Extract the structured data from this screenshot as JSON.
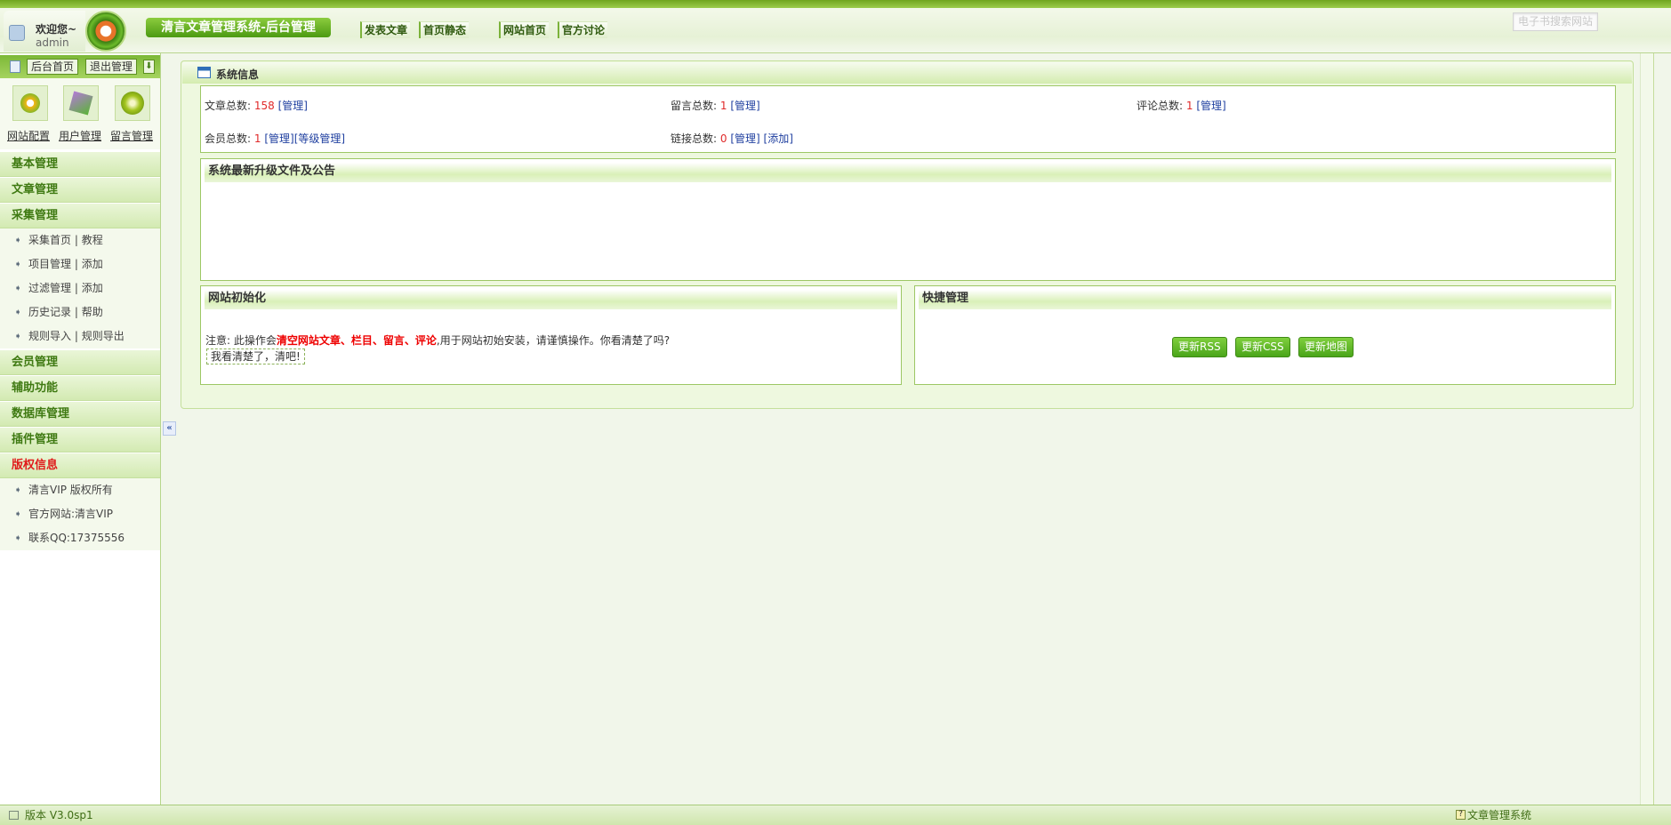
{
  "header": {
    "welcome": "欢迎您~",
    "username": "admin",
    "title": "清言文章管理系统-后台管理",
    "nav": [
      "发表文章",
      "首页静态",
      "网站首页",
      "官方讨论"
    ],
    "search_placeholder": "电子书搜索网站"
  },
  "sidebar": {
    "toolbar": [
      "后台首页",
      "退出管理"
    ],
    "quick": [
      "网站配置",
      "用户管理",
      "留言管理"
    ],
    "menus": {
      "basic": "基本管理",
      "article": "文章管理",
      "collect": "采集管理",
      "collect_items": [
        [
          "采集首页",
          "教程"
        ],
        [
          "项目管理",
          "添加"
        ],
        [
          "过滤管理",
          "添加"
        ],
        [
          "历史记录",
          "帮助"
        ],
        [
          "规则导入",
          "规则导出"
        ]
      ],
      "member": "会员管理",
      "aux": "辅助功能",
      "db": "数据库管理",
      "plugin": "插件管理",
      "copyright": "版权信息",
      "copyright_items": [
        "清言VIP 版权所有",
        "官方网站:清言VIP",
        "联系QQ:17375556"
      ]
    },
    "collapse": "«"
  },
  "main": {
    "panel_title": "系统信息",
    "stats": {
      "articles": {
        "label": "文章总数:",
        "value": "158",
        "links": [
          "[管理]"
        ]
      },
      "messages": {
        "label": "留言总数:",
        "value": "1",
        "links": [
          "[管理]"
        ]
      },
      "comments": {
        "label": "评论总数:",
        "value": "1",
        "links": [
          "[管理]"
        ]
      },
      "members": {
        "label": "会员总数:",
        "value": "1",
        "links": [
          "[管理]",
          "[等级管理]"
        ]
      },
      "links": {
        "label": "链接总数:",
        "value": "0",
        "links": [
          "[管理]",
          "[添加]"
        ]
      }
    },
    "announce_title": "系统最新升级文件及公告",
    "init": {
      "title": "网站初始化",
      "note_prefix": "注意: 此操作会",
      "note_red": "清空网站文章、栏目、留言、评论",
      "note_suffix": ",用于网站初始安装，请谨慎操作。你看清楚了吗?",
      "button": "我看清楚了，清吧!"
    },
    "quick": {
      "title": "快捷管理",
      "buttons": [
        "更新RSS",
        "更新CSS",
        "更新地图"
      ]
    }
  },
  "footer": {
    "version": "版本 V3.0sp1",
    "right": "文章管理系统",
    "help_icon": "?"
  }
}
